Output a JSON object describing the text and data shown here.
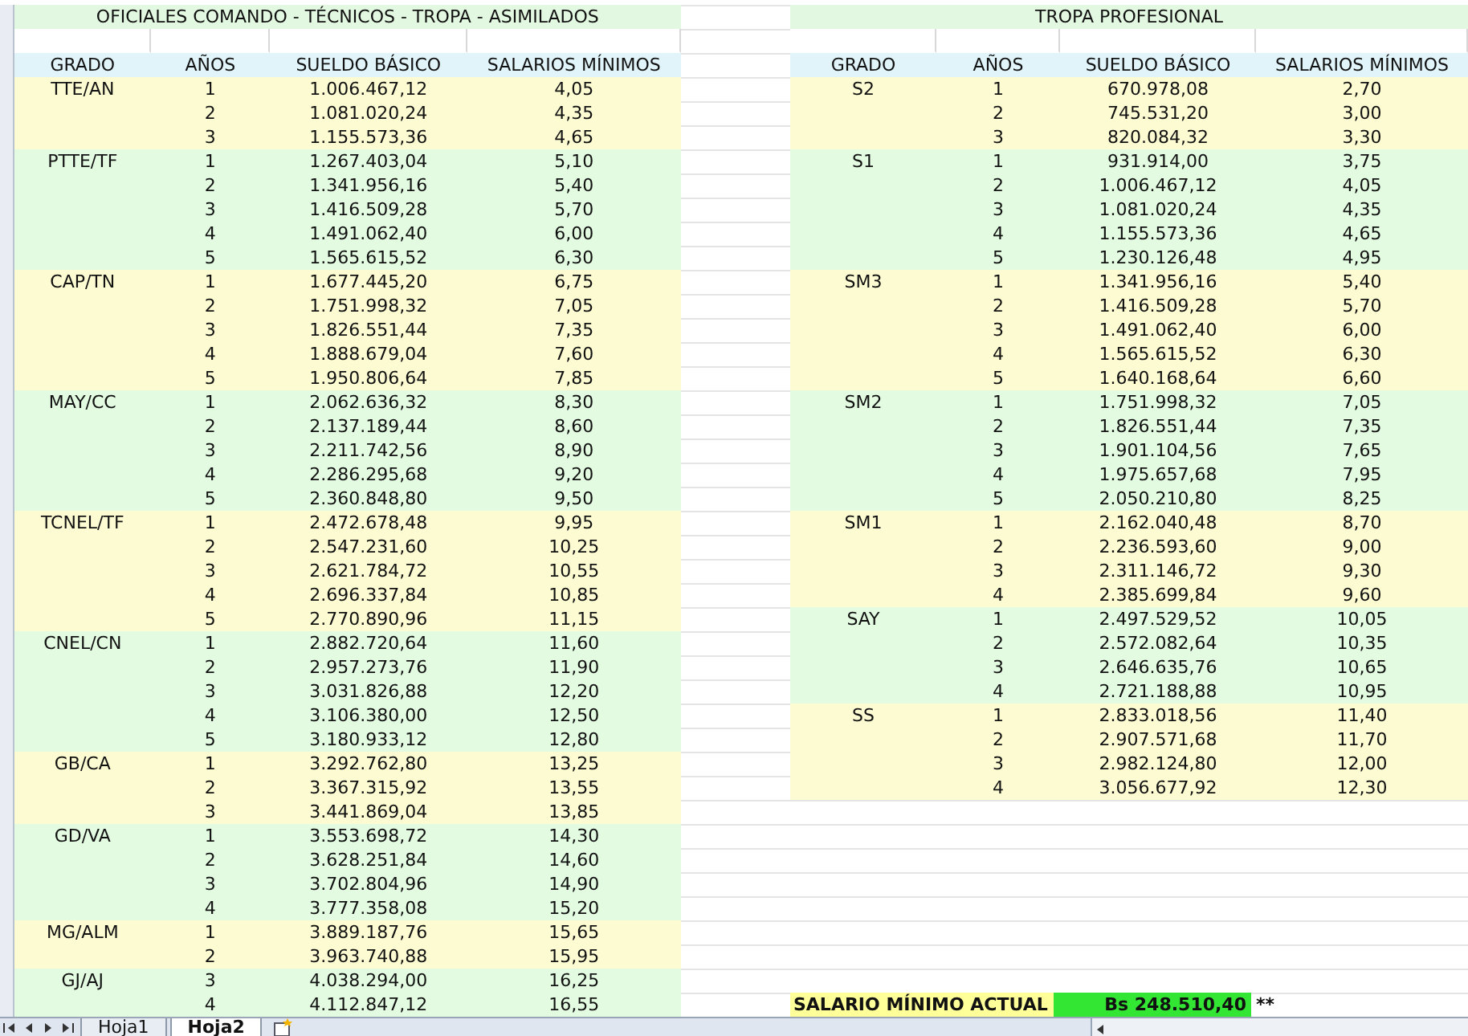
{
  "left_table": {
    "title": "OFICIALES COMANDO - TÉCNICOS - TROPA - ASIMILADOS",
    "columns": [
      "GRADO",
      "AÑOS",
      "SUELDO BÁSICO",
      "SALARIOS MÍNIMOS"
    ],
    "groups": [
      {
        "grado": "TTE/AN",
        "color": "#fdfbd2",
        "rows": [
          {
            "anos": "1",
            "sueldo": "1.006.467,12",
            "salarios": "4,05"
          },
          {
            "anos": "2",
            "sueldo": "1.081.020,24",
            "salarios": "4,35"
          },
          {
            "anos": "3",
            "sueldo": "1.155.573,36",
            "salarios": "4,65"
          }
        ]
      },
      {
        "grado": "PTTE/TF",
        "color": "#e3fbe1",
        "rows": [
          {
            "anos": "1",
            "sueldo": "1.267.403,04",
            "salarios": "5,10"
          },
          {
            "anos": "2",
            "sueldo": "1.341.956,16",
            "salarios": "5,40"
          },
          {
            "anos": "3",
            "sueldo": "1.416.509,28",
            "salarios": "5,70"
          },
          {
            "anos": "4",
            "sueldo": "1.491.062,40",
            "salarios": "6,00"
          },
          {
            "anos": "5",
            "sueldo": "1.565.615,52",
            "salarios": "6,30"
          }
        ]
      },
      {
        "grado": "CAP/TN",
        "color": "#fdfbd2",
        "rows": [
          {
            "anos": "1",
            "sueldo": "1.677.445,20",
            "salarios": "6,75"
          },
          {
            "anos": "2",
            "sueldo": "1.751.998,32",
            "salarios": "7,05"
          },
          {
            "anos": "3",
            "sueldo": "1.826.551,44",
            "salarios": "7,35"
          },
          {
            "anos": "4",
            "sueldo": "1.888.679,04",
            "salarios": "7,60"
          },
          {
            "anos": "5",
            "sueldo": "1.950.806,64",
            "salarios": "7,85"
          }
        ]
      },
      {
        "grado": "MAY/CC",
        "color": "#e3fbe1",
        "rows": [
          {
            "anos": "1",
            "sueldo": "2.062.636,32",
            "salarios": "8,30"
          },
          {
            "anos": "2",
            "sueldo": "2.137.189,44",
            "salarios": "8,60"
          },
          {
            "anos": "3",
            "sueldo": "2.211.742,56",
            "salarios": "8,90"
          },
          {
            "anos": "4",
            "sueldo": "2.286.295,68",
            "salarios": "9,20"
          },
          {
            "anos": "5",
            "sueldo": "2.360.848,80",
            "salarios": "9,50"
          }
        ]
      },
      {
        "grado": "TCNEL/TF",
        "color": "#fdfbd2",
        "rows": [
          {
            "anos": "1",
            "sueldo": "2.472.678,48",
            "salarios": "9,95"
          },
          {
            "anos": "2",
            "sueldo": "2.547.231,60",
            "salarios": "10,25"
          },
          {
            "anos": "3",
            "sueldo": "2.621.784,72",
            "salarios": "10,55"
          },
          {
            "anos": "4",
            "sueldo": "2.696.337,84",
            "salarios": "10,85"
          },
          {
            "anos": "5",
            "sueldo": "2.770.890,96",
            "salarios": "11,15"
          }
        ]
      },
      {
        "grado": "CNEL/CN",
        "color": "#e3fbe1",
        "rows": [
          {
            "anos": "1",
            "sueldo": "2.882.720,64",
            "salarios": "11,60"
          },
          {
            "anos": "2",
            "sueldo": "2.957.273,76",
            "salarios": "11,90"
          },
          {
            "anos": "3",
            "sueldo": "3.031.826,88",
            "salarios": "12,20"
          },
          {
            "anos": "4",
            "sueldo": "3.106.380,00",
            "salarios": "12,50"
          },
          {
            "anos": "5",
            "sueldo": "3.180.933,12",
            "salarios": "12,80"
          }
        ]
      },
      {
        "grado": "GB/CA",
        "color": "#fdfbd2",
        "rows": [
          {
            "anos": "1",
            "sueldo": "3.292.762,80",
            "salarios": "13,25"
          },
          {
            "anos": "2",
            "sueldo": "3.367.315,92",
            "salarios": "13,55"
          },
          {
            "anos": "3",
            "sueldo": "3.441.869,04",
            "salarios": "13,85"
          }
        ]
      },
      {
        "grado": "GD/VA",
        "color": "#e3fbe1",
        "rows": [
          {
            "anos": "1",
            "sueldo": "3.553.698,72",
            "salarios": "14,30"
          },
          {
            "anos": "2",
            "sueldo": "3.628.251,84",
            "salarios": "14,60"
          },
          {
            "anos": "3",
            "sueldo": "3.702.804,96",
            "salarios": "14,90"
          },
          {
            "anos": "4",
            "sueldo": "3.777.358,08",
            "salarios": "15,20"
          }
        ]
      },
      {
        "grado": "MG/ALM",
        "color": "#fdfbd2",
        "rows": [
          {
            "anos": "1",
            "sueldo": "3.889.187,76",
            "salarios": "15,65"
          },
          {
            "anos": "2",
            "sueldo": "3.963.740,88",
            "salarios": "15,95"
          }
        ]
      },
      {
        "grado": "GJ/AJ",
        "color": "#e3fbe1",
        "rows": [
          {
            "anos": "3",
            "sueldo": "4.038.294,00",
            "salarios": "16,25"
          },
          {
            "anos": "4",
            "sueldo": "4.112.847,12",
            "salarios": "16,55"
          }
        ]
      }
    ]
  },
  "right_table": {
    "title": "TROPA PROFESIONAL",
    "columns": [
      "GRADO",
      "AÑOS",
      "SUELDO BÁSICO",
      "SALARIOS MÍNIMOS"
    ],
    "groups": [
      {
        "grado": "S2",
        "color": "#fdfbd2",
        "rows": [
          {
            "anos": "1",
            "sueldo": "670.978,08",
            "salarios": "2,70"
          },
          {
            "anos": "2",
            "sueldo": "745.531,20",
            "salarios": "3,00"
          },
          {
            "anos": "3",
            "sueldo": "820.084,32",
            "salarios": "3,30"
          }
        ]
      },
      {
        "grado": "S1",
        "color": "#e3fbe1",
        "rows": [
          {
            "anos": "1",
            "sueldo": "931.914,00",
            "salarios": "3,75"
          },
          {
            "anos": "2",
            "sueldo": "1.006.467,12",
            "salarios": "4,05"
          },
          {
            "anos": "3",
            "sueldo": "1.081.020,24",
            "salarios": "4,35"
          },
          {
            "anos": "4",
            "sueldo": "1.155.573,36",
            "salarios": "4,65"
          },
          {
            "anos": "5",
            "sueldo": "1.230.126,48",
            "salarios": "4,95"
          }
        ]
      },
      {
        "grado": "SM3",
        "color": "#fdfbd2",
        "rows": [
          {
            "anos": "1",
            "sueldo": "1.341.956,16",
            "salarios": "5,40"
          },
          {
            "anos": "2",
            "sueldo": "1.416.509,28",
            "salarios": "5,70"
          },
          {
            "anos": "3",
            "sueldo": "1.491.062,40",
            "salarios": "6,00"
          },
          {
            "anos": "4",
            "sueldo": "1.565.615,52",
            "salarios": "6,30"
          },
          {
            "anos": "5",
            "sueldo": "1.640.168,64",
            "salarios": "6,60"
          }
        ]
      },
      {
        "grado": "SM2",
        "color": "#e3fbe1",
        "rows": [
          {
            "anos": "1",
            "sueldo": "1.751.998,32",
            "salarios": "7,05"
          },
          {
            "anos": "2",
            "sueldo": "1.826.551,44",
            "salarios": "7,35"
          },
          {
            "anos": "3",
            "sueldo": "1.901.104,56",
            "salarios": "7,65"
          },
          {
            "anos": "4",
            "sueldo": "1.975.657,68",
            "salarios": "7,95"
          },
          {
            "anos": "5",
            "sueldo": "2.050.210,80",
            "salarios": "8,25"
          }
        ]
      },
      {
        "grado": "SM1",
        "color": "#fdfbd2",
        "rows": [
          {
            "anos": "1",
            "sueldo": "2.162.040,48",
            "salarios": "8,70"
          },
          {
            "anos": "2",
            "sueldo": "2.236.593,60",
            "salarios": "9,00"
          },
          {
            "anos": "3",
            "sueldo": "2.311.146,72",
            "salarios": "9,30"
          },
          {
            "anos": "4",
            "sueldo": "2.385.699,84",
            "salarios": "9,60"
          }
        ]
      },
      {
        "grado": "SAY",
        "color": "#e3fbe1",
        "rows": [
          {
            "anos": "1",
            "sueldo": "2.497.529,52",
            "salarios": "10,05"
          },
          {
            "anos": "2",
            "sueldo": "2.572.082,64",
            "salarios": "10,35"
          },
          {
            "anos": "3",
            "sueldo": "2.646.635,76",
            "salarios": "10,65"
          },
          {
            "anos": "4",
            "sueldo": "2.721.188,88",
            "salarios": "10,95"
          }
        ]
      },
      {
        "grado": "SS",
        "color": "#fdfbd2",
        "rows": [
          {
            "anos": "1",
            "sueldo": "2.833.018,56",
            "salarios": "11,40"
          },
          {
            "anos": "2",
            "sueldo": "2.907.571,68",
            "salarios": "11,70"
          },
          {
            "anos": "3",
            "sueldo": "2.982.124,80",
            "salarios": "12,00"
          },
          {
            "anos": "4",
            "sueldo": "3.056.677,92",
            "salarios": "12,30"
          }
        ]
      }
    ]
  },
  "minimum_wage": {
    "label": "SALARIO MÍNIMO ACTUAL",
    "value": "Bs 248.510,40",
    "note": "**"
  },
  "sheet_tabs": [
    {
      "label": "Hoja1",
      "selected": false
    },
    {
      "label": "Hoja2",
      "selected": true
    }
  ]
}
